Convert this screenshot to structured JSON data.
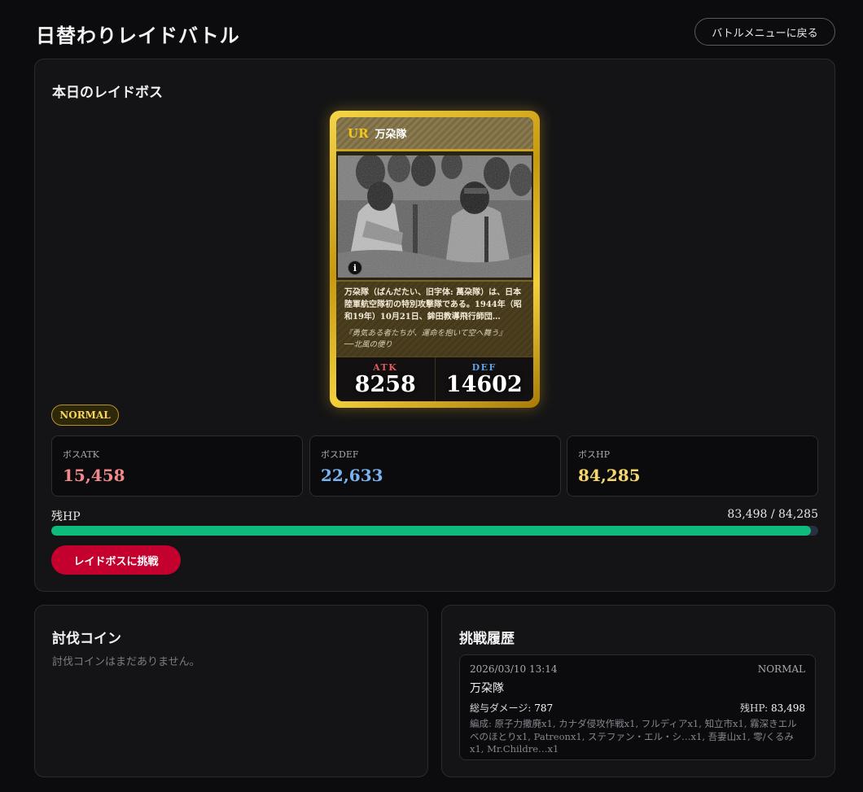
{
  "header": {
    "title": "日替わりレイドバトル",
    "back_label": "バトルメニューに戻る"
  },
  "raid": {
    "heading": "本日のレイドボス",
    "card": {
      "rarity": "UR",
      "name": "万朶隊",
      "description": "万朶隊（ばんだたい、旧字体: 萬朶隊）は、日本陸軍航空隊初の特別攻撃隊である。1944年（昭和19年）10月21日、鉾田教導飛行師団…",
      "quote_line1": "『勇気ある者たちが、運命を抱いて空へ舞う』",
      "quote_line2": "──北風の便り",
      "atk_label": "ATK",
      "atk_value": "8258",
      "def_label": "DEF",
      "def_value": "14602",
      "info_label": "i"
    },
    "difficulty": "NORMAL",
    "stats": [
      {
        "label": "ボスATK",
        "value": "15,458",
        "color": "#f08a8a"
      },
      {
        "label": "ボスDEF",
        "value": "22,633",
        "color": "#7ab4f0"
      },
      {
        "label": "ボスHP",
        "value": "84,285",
        "color": "#f5d76e"
      }
    ],
    "hp": {
      "label": "残HP",
      "readout": "83,498 / 84,285",
      "fraction": 0.9907
    },
    "challenge_label": "レイドボスに挑戦"
  },
  "coins": {
    "heading": "討伐コイン",
    "empty": "討伐コインはまだありません。"
  },
  "history": {
    "heading": "挑戦履歴",
    "entries": [
      {
        "date": "2026/03/10 13:14",
        "difficulty": "NORMAL",
        "boss": "万朶隊",
        "damage_label": "総与ダメージ:",
        "damage": "787",
        "remaining_label": "残HP:",
        "remaining": "83,498",
        "lineup": "編成: 原子力撒廃x1, カナダ侵攻作戦x1, フルディアx1, 知立市x1, 霧深きエルベのほとりx1, Patreonx1, ステファン・エル・シ…x1, 吾妻山x1, 零/くるみx1, Mr.Childre…x1"
      }
    ]
  }
}
